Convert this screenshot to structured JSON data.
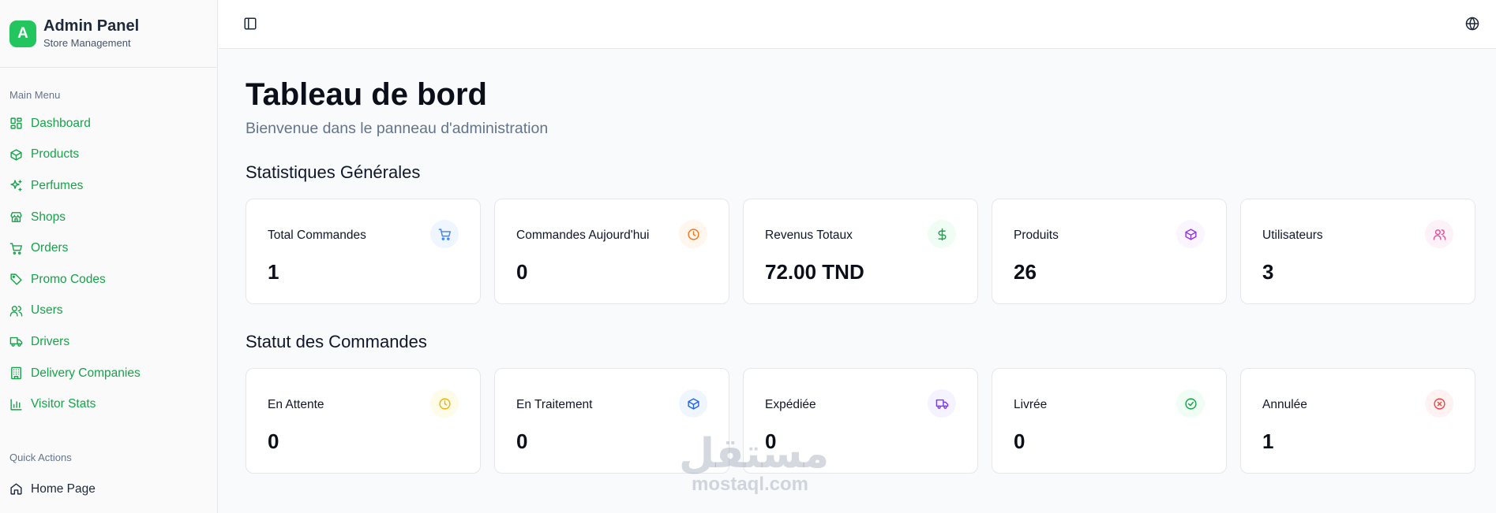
{
  "brand": {
    "logo_letter": "A",
    "title": "Admin Panel",
    "subtitle": "Store Management",
    "accent": "#22c55e"
  },
  "sidebar": {
    "main_label": "Main Menu",
    "items": [
      {
        "label": "Dashboard",
        "icon": "layout-dashboard-icon"
      },
      {
        "label": "Products",
        "icon": "package-icon"
      },
      {
        "label": "Perfumes",
        "icon": "sparkles-icon"
      },
      {
        "label": "Shops",
        "icon": "store-icon"
      },
      {
        "label": "Orders",
        "icon": "shopping-cart-icon"
      },
      {
        "label": "Promo Codes",
        "icon": "tag-icon"
      },
      {
        "label": "Users",
        "icon": "users-icon"
      },
      {
        "label": "Drivers",
        "icon": "truck-icon"
      },
      {
        "label": "Delivery Companies",
        "icon": "building-icon"
      },
      {
        "label": "Visitor Stats",
        "icon": "bar-chart-icon"
      }
    ],
    "quick_label": "Quick Actions",
    "quick_items": [
      {
        "label": "Home Page",
        "icon": "home-icon"
      }
    ]
  },
  "main": {
    "title": "Tableau de bord",
    "subtitle": "Bienvenue dans le panneau d'administration",
    "general_title": "Statistiques Générales",
    "general": [
      {
        "label": "Total Commandes",
        "value": "1",
        "icon": "shopping-cart-icon",
        "color": "#3b82f6",
        "bg": "#eff6ff"
      },
      {
        "label": "Commandes Aujourd'hui",
        "value": "0",
        "icon": "clock-icon",
        "color": "#f97316",
        "bg": "#fff7ed"
      },
      {
        "label": "Revenus Totaux",
        "value": "72.00 TND",
        "icon": "dollar-sign-icon",
        "color": "#16a34a",
        "bg": "#f0fdf4"
      },
      {
        "label": "Produits",
        "value": "26",
        "icon": "package-icon",
        "color": "#9333ea",
        "bg": "#faf5ff"
      },
      {
        "label": "Utilisateurs",
        "value": "3",
        "icon": "users-icon",
        "color": "#ec4899",
        "bg": "#fdf2f8"
      }
    ],
    "status_title": "Statut des Commandes",
    "status": [
      {
        "label": "En Attente",
        "value": "0",
        "icon": "clock-icon",
        "color": "#eab308",
        "bg": "#fefce8"
      },
      {
        "label": "En Traitement",
        "value": "0",
        "icon": "package-icon",
        "color": "#2563eb",
        "bg": "#eff6ff"
      },
      {
        "label": "Expédiée",
        "value": "0",
        "icon": "truck-icon",
        "color": "#7c3aed",
        "bg": "#f5f3ff"
      },
      {
        "label": "Livrée",
        "value": "0",
        "icon": "check-circle-icon",
        "color": "#16a34a",
        "bg": "#f0fdf4"
      },
      {
        "label": "Annulée",
        "value": "1",
        "icon": "x-circle-icon",
        "color": "#ef4444",
        "bg": "#fef2f2"
      }
    ]
  },
  "watermark": {
    "arabic": "مستقل",
    "latin": "mostaql.com"
  }
}
